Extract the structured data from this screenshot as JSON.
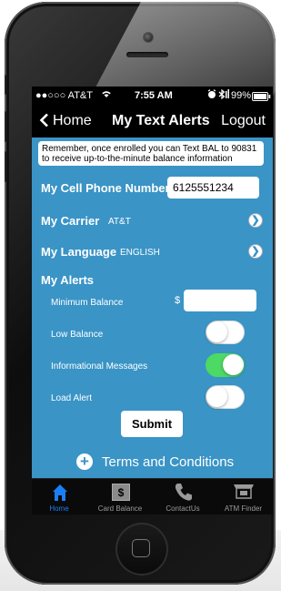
{
  "status_bar": {
    "carrier": "●●○○○ AT&T",
    "time": "7:55 AM",
    "battery": "99%",
    "icons": [
      "wifi-icon",
      "alarm-icon",
      "bluetooth-icon",
      "battery-icon"
    ]
  },
  "nav": {
    "back_label": "Home",
    "title": "My Text Alerts",
    "right_label": "Logout"
  },
  "notice": "Remember, once enrolled you can Text BAL to 90831 to receive up-to-the-minute balance information",
  "cell_phone": {
    "label": "My Cell Phone Number",
    "value": "6125551234"
  },
  "carrier": {
    "label": "My Carrier",
    "value": "AT&T"
  },
  "language": {
    "label": "My Language",
    "value": "ENGLISH"
  },
  "alerts": {
    "label": "My Alerts",
    "minimum_balance_label": "Minimum Balance",
    "currency_symbol": "$",
    "minimum_balance_value": "",
    "items": [
      {
        "label": "Low Balance",
        "enabled": false
      },
      {
        "label": "Informational Messages",
        "enabled": true
      },
      {
        "label": "Load Alert",
        "enabled": false
      }
    ]
  },
  "submit_label": "Submit",
  "terms_label": "Terms and Conditions",
  "tabs": [
    {
      "label": "Home",
      "icon": "home-icon",
      "active": true
    },
    {
      "label": "Card Balance",
      "icon": "dollar-icon",
      "active": false
    },
    {
      "label": "ContactUs",
      "icon": "phone-icon",
      "active": false
    },
    {
      "label": "ATM Finder",
      "icon": "atm-icon",
      "active": false
    }
  ],
  "colors": {
    "screen_bg": "#3a94c6",
    "toggle_on": "#4cd964",
    "active_tab": "#1a7ff5"
  }
}
